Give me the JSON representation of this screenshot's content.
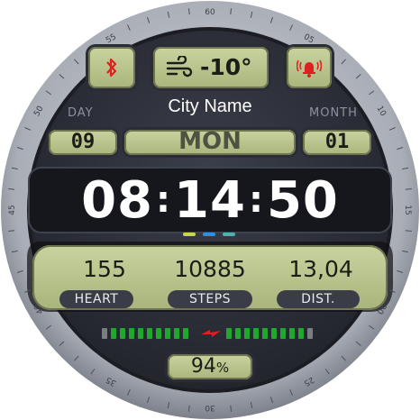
{
  "status": {
    "bluetooth_icon": "bluetooth-icon",
    "weather_icon": "wind-icon",
    "temperature": "-10°",
    "alarm_icon": "alarm-bell-icon"
  },
  "city": "City Name",
  "labels": {
    "day": "DAY",
    "month": "MONTH"
  },
  "date": {
    "day": "09",
    "weekday": "MON",
    "month": "01"
  },
  "time": {
    "hh": "08",
    "mm": "14",
    "ss": "50"
  },
  "stats": {
    "heart": {
      "value": "155",
      "label": "HEART"
    },
    "steps": {
      "value": "10885",
      "label": "STEPS"
    },
    "distance": {
      "value": "13,04",
      "label": "DIST."
    }
  },
  "battery": {
    "percent_text": "94",
    "unit": "%",
    "level": 0.94,
    "bar_icon": "charging-bolt-icon"
  },
  "bezel_numbers": [
    "60",
    "05",
    "10",
    "15",
    "20",
    "25",
    "30",
    "35",
    "40",
    "45",
    "50",
    "55"
  ],
  "colors": {
    "lcd": "#b8c28b",
    "accent_red": "#e02020",
    "battery_green": "#1fa82d"
  }
}
